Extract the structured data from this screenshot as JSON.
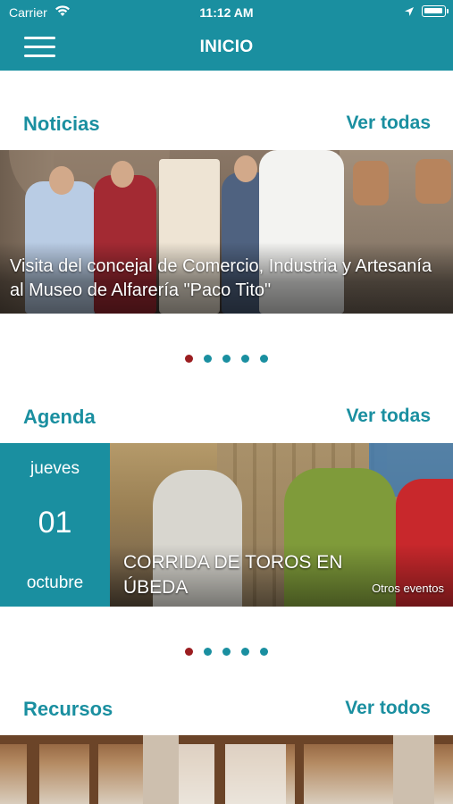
{
  "status_bar": {
    "carrier": "Carrier",
    "time": "11:12 AM",
    "wifi_icon": "wifi-icon",
    "location_icon": "location-arrow-icon",
    "battery_icon": "battery-full-icon"
  },
  "nav": {
    "title": "INICIO",
    "menu_icon": "hamburger-menu-icon"
  },
  "colors": {
    "primary": "#1a8fa0",
    "active_dot": "#9b1d20",
    "text_on_primary": "#ffffff"
  },
  "news": {
    "section_title": "Noticias",
    "link_label": "Ver todas",
    "title": "Visita del concejal de Comercio, Industria y Artesanía al Museo de Alfarería \"Paco Tito\"",
    "carousel": {
      "count": 5,
      "active_index": 0
    }
  },
  "agenda": {
    "section_title": "Agenda",
    "link_label": "Ver todas",
    "weekday": "jueves",
    "day": "01",
    "month": "octubre",
    "event_title": "CORRIDA DE TOROS EN ÚBEDA",
    "other_events_label": "Otros eventos",
    "carousel": {
      "count": 5,
      "active_index": 0
    }
  },
  "resources": {
    "section_title": "Recursos",
    "link_label": "Ver todos"
  }
}
